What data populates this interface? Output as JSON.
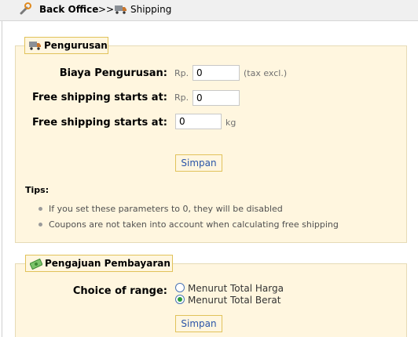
{
  "breadcrumb": {
    "root": "Back Office",
    "separator": ">>",
    "current": "Shipping"
  },
  "handling": {
    "legend": "Pengurusan",
    "rows": [
      {
        "label": "Biaya Pengurusan:",
        "prefix": "Rp.",
        "value": "0",
        "suffix": "(tax excl.)"
      },
      {
        "label": "Free shipping starts at:",
        "prefix": "Rp.",
        "value": "0"
      },
      {
        "label": "Free shipping starts at:",
        "value": "0",
        "suffix": "kg"
      }
    ],
    "save_label": "Simpan",
    "tips_title": "Tips:",
    "tips": [
      "If you set these parameters to 0, they will be disabled",
      "Coupons are not taken into account when calculating free shipping"
    ]
  },
  "billing": {
    "legend": "Pengajuan Pembayaran",
    "range_label": "Choice of range:",
    "options": [
      {
        "label": "Menurut Total Harga",
        "selected": false
      },
      {
        "label": "Menurut Total Berat",
        "selected": true
      }
    ],
    "save_label": "Simpan"
  },
  "icons": {
    "breadcrumb_root": "wrench-icon",
    "breadcrumb_current": "truck-icon",
    "handling_legend": "truck-icon",
    "billing_legend": "money-icon"
  },
  "colors": {
    "panel_bg": "#fff6df",
    "panel_border": "#e6dbb6",
    "legend_border": "#e1c25a",
    "link_blue": "#2a55a8",
    "topbar_bg": "#f0f0f0"
  }
}
